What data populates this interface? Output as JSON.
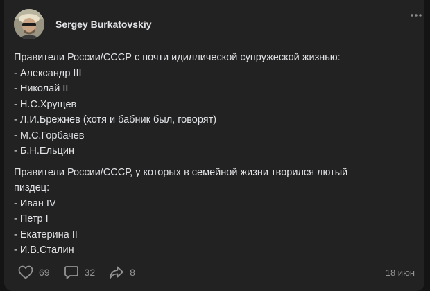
{
  "post": {
    "author": "Sergey Burkatovskiy",
    "paragraph1": {
      "lines": [
        "Правители России/СССР с почти идиллической супружеской жизнью:",
        "- Александр III",
        "- Николай II",
        "- Н.С.Хрущев",
        "- Л.И.Брежнев (хотя и бабник был, говорят)",
        "- М.С.Горбачев",
        "- Б.Н.Ельцин"
      ]
    },
    "paragraph2": {
      "lines": [
        "Правители России/СССР, у которых в семейной жизни творился лютый",
        "пиздец:",
        "- Иван IV",
        "- Петр I",
        "- Екатерина II",
        "- И.В.Сталин"
      ]
    },
    "likes": "69",
    "comments": "32",
    "shares": "8",
    "date": "18 июн"
  },
  "icons": {
    "avatar": "avatar",
    "more": "more-horizontal-icon",
    "like": "heart-icon",
    "comment": "comment-icon",
    "share": "share-icon"
  },
  "colors": {
    "background": "#141414",
    "card": "#222222",
    "text": "#e1e3e6",
    "secondary": "#939393"
  }
}
